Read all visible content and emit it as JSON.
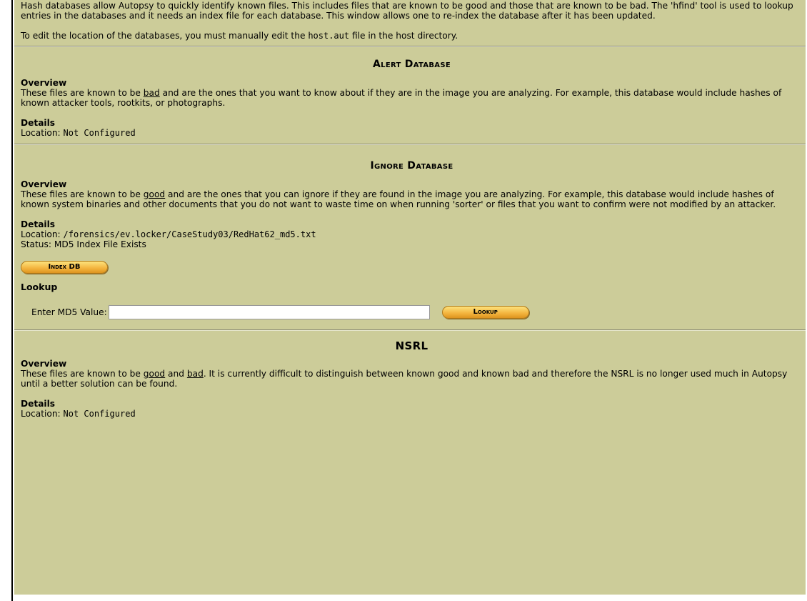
{
  "intro": {
    "para1": "Hash databases allow Autopsy to quickly identify known files. This includes files that are known to be good and those that are known to be bad. The 'hfind' tool is used to lookup entries in the databases and it needs an index file for each database. This window allows one to re-index the database after it has been updated.",
    "para2_prefix": "To edit the location of the databases, you must manually edit the ",
    "para2_code": "host.aut",
    "para2_suffix": " file in the host directory."
  },
  "alert": {
    "title": "Alert Database",
    "overview_label": "Overview",
    "overview_pre": "These files are known to be ",
    "overview_keyword": "bad",
    "overview_post": " and are the ones that you want to know about if they are in the image you are analyzing. For example, this database would include hashes of known attacker tools, rootkits, or photographs.",
    "details_label": "Details",
    "location_label": "Location: ",
    "location_value": "Not Configured"
  },
  "ignore": {
    "title": "Ignore Database",
    "overview_label": "Overview",
    "overview_pre": "These files are known to be ",
    "overview_keyword": "good",
    "overview_post": " and are the ones that you can ignore if they are found in the image you are analyzing. For example, this database would include hashes of known system binaries and other documents that you do not want to waste time on when running 'sorter' or files that you want to confirm were not modified by an attacker.",
    "details_label": "Details",
    "location_label": "Location: ",
    "location_value": "/forensics/ev.locker/CaseStudy03/RedHat62_md5.txt",
    "status_text": "Status: MD5 Index File Exists",
    "index_button": "Index DB",
    "lookup_label": "Lookup",
    "md5_label": "Enter MD5 Value:",
    "md5_value": "",
    "lookup_button": "Lookup"
  },
  "nsrl": {
    "title": "NSRL",
    "overview_label": "Overview",
    "overview_pre": "These files are known to be ",
    "overview_kw1": "good",
    "overview_mid": " and ",
    "overview_kw2": "bad",
    "overview_post": ". It is currently difficult to distinguish between known good and known bad and therefore the NSRL is no longer used much in Autopsy until a better solution can be found.",
    "details_label": "Details",
    "location_label": "Location: ",
    "location_value": "Not Configured"
  },
  "colors": {
    "panel_bg": "#cccc99",
    "button_orange": "#f3b33d"
  }
}
